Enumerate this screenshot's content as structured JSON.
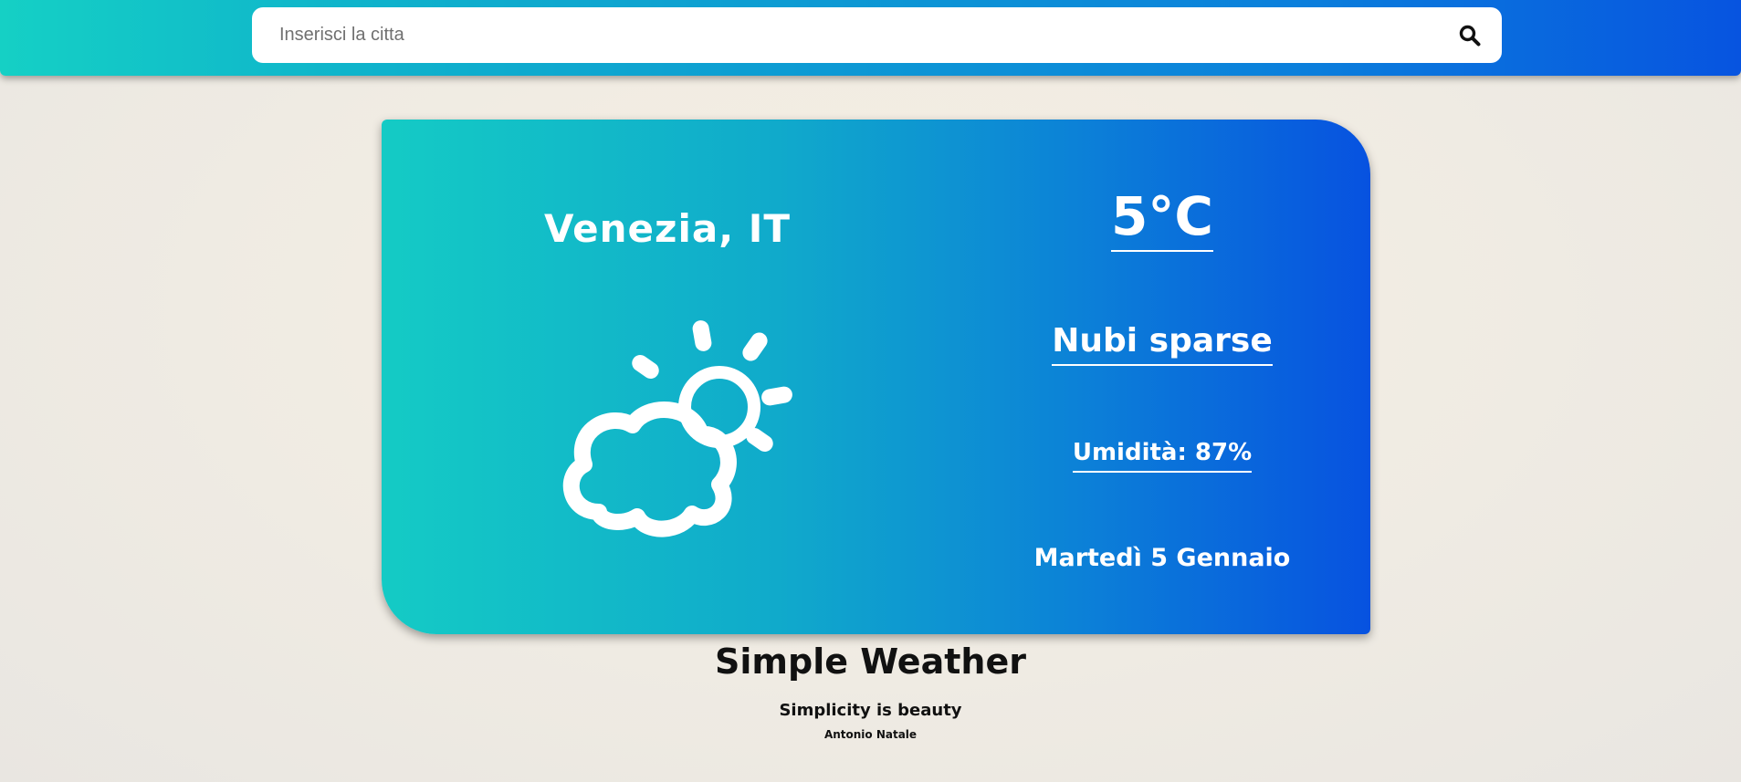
{
  "search": {
    "placeholder": "Inserisci la citta",
    "value": "",
    "icon": "search-icon"
  },
  "weather": {
    "city": "Venezia, IT",
    "temperature": "5°C",
    "description": "Nubi sparse",
    "humidity": "Umidità: 87%",
    "date": "Martedì 5 Gennaio",
    "icon": "partly-cloudy-icon"
  },
  "footer": {
    "title": "Simple Weather",
    "tagline": "Simplicity is beauty",
    "author": "Antonio Natale"
  },
  "colors": {
    "gradient_start": "#15d0c5",
    "gradient_end": "#0754e0",
    "text_on_card": "#ffffff",
    "page_background": "#efebe3"
  }
}
